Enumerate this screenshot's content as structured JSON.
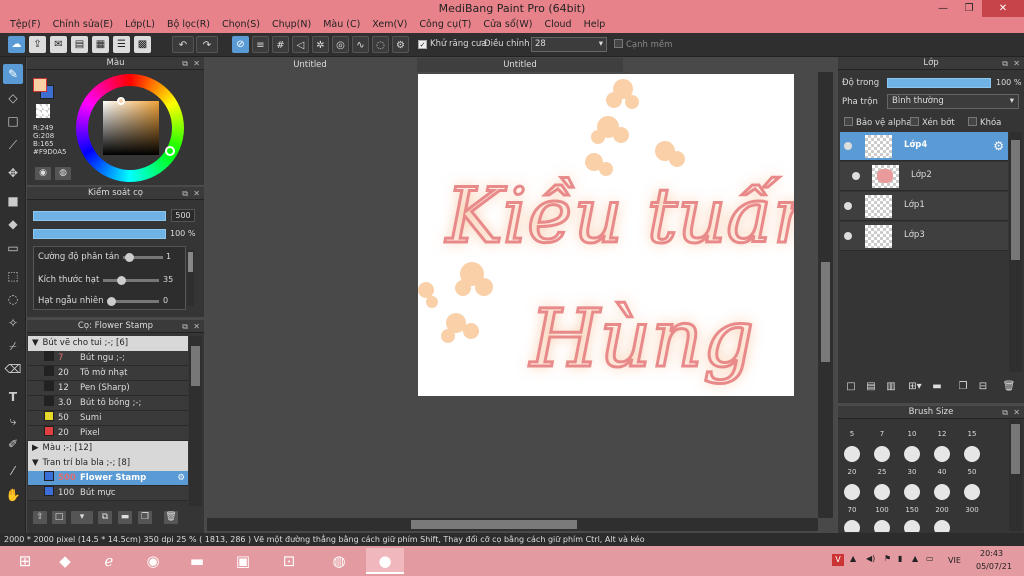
{
  "window": {
    "title": "MediBang Paint Pro (64bit)"
  },
  "menu": [
    "Tệp(F)",
    "Chỉnh sửa(E)",
    "Lớp(L)",
    "Bộ lọc(R)",
    "Chọn(S)",
    "Chụp(N)",
    "Màu (C)",
    "Xem(V)",
    "Công cụ(T)",
    "Cửa sổ(W)",
    "Cloud",
    "Help"
  ],
  "toolbar": {
    "antialias_label": "Khử răng cưa",
    "correction_label": "Điều chỉnh",
    "correction_value": "28",
    "soft_edge_label": "Cạnh mềm"
  },
  "color_panel": {
    "title": "Màu",
    "readout": [
      "R:249",
      "G:208",
      "B:165",
      "#F9D0A5"
    ],
    "main_color": "#f9d0a5"
  },
  "brush_control": {
    "title": "Kiểm soát cọ",
    "size_value": "500",
    "opacity_value": "100 %",
    "params": [
      {
        "label": "Cường độ phân tán",
        "value": "1"
      },
      {
        "label": "Kích thước hạt",
        "value": "35"
      },
      {
        "label": "Hạt ngẫu nhiên",
        "value": "0"
      }
    ]
  },
  "brush_list": {
    "title": "Cọ: Flower Stamp",
    "rows": [
      {
        "kind": "group",
        "arrow": "▼",
        "label": "Bút vẽ cho tui ;-; [6]"
      },
      {
        "kind": "brush",
        "size": "7",
        "label": "Bút ngu ;-;",
        "color": "#222222"
      },
      {
        "kind": "brush",
        "size": "20",
        "label": "Tô mờ nhạt",
        "color": "#222222"
      },
      {
        "kind": "brush",
        "size": "12",
        "label": "Pen (Sharp)",
        "color": "#222222"
      },
      {
        "kind": "brush",
        "size": "3.0",
        "label": "Bút tô bóng ;-;",
        "color": "#222222"
      },
      {
        "kind": "brush",
        "size": "50",
        "label": "Sumi",
        "color": "#e6d82a"
      },
      {
        "kind": "brush",
        "size": "20",
        "label": "Pixel",
        "color": "#e04040"
      },
      {
        "kind": "group",
        "arrow": "▶",
        "label": "Màu ;-; [12]"
      },
      {
        "kind": "group",
        "arrow": "▼",
        "label": "Tran trí bla bla ;-; [8]"
      },
      {
        "kind": "brush",
        "size": "500",
        "label": "Flower Stamp",
        "color": "#3a6fd8",
        "selected": true
      },
      {
        "kind": "brush",
        "size": "100",
        "label": "Bút mực",
        "color": "#3a6fd8"
      }
    ]
  },
  "documents": {
    "tabs": [
      "Untitled",
      "Untitled"
    ]
  },
  "layers": {
    "title": "Lớp",
    "opacity_label": "Độ trong",
    "opacity_value": "100 %",
    "opacity_fraction": 1.0,
    "blend_label": "Pha trộn",
    "blend_value": "Bình thường",
    "protect_alpha": "Bảo vệ alpha",
    "clip": "Xén bớt",
    "lock": "Khóa",
    "items": [
      "Lớp4",
      "Lớp2",
      "Lớp1",
      "Lớp3"
    ]
  },
  "brush_size": {
    "title": "Brush Size",
    "sizes": [
      "5",
      "7",
      "10",
      "12",
      "15",
      "20",
      "25",
      "30",
      "40",
      "50",
      "70",
      "100",
      "150",
      "200",
      "300"
    ]
  },
  "canvas_text": {
    "line1": "Kiều tuấn",
    "line2": "Hùng"
  },
  "status": {
    "text": "2000 * 2000 pixel   (14.5 * 14.5cm)   350 dpi   25 %   ( 1813, 286 )   Vẽ một đường thẳng bằng cách giữ phím Shift, Thay đổi cỡ cọ bằng cách giữ phím Ctrl, Alt và kéo"
  },
  "tray": {
    "lang": "VIE",
    "time": "20:43",
    "date": "05/07/21"
  }
}
